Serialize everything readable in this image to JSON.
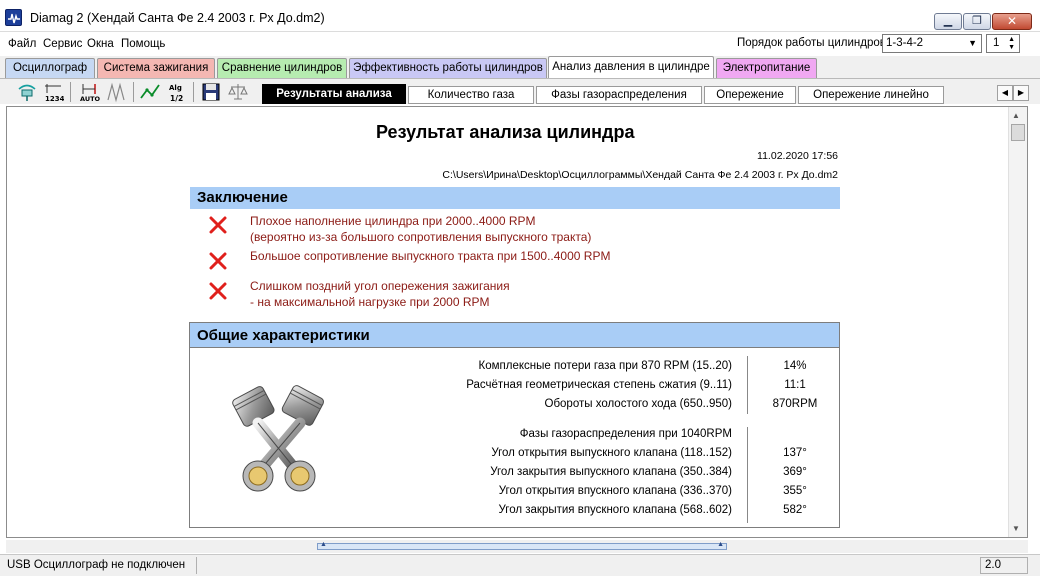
{
  "window": {
    "title": "Diamag 2 (Хендай Санта Фе 2.4 2003 г. Рх До.dm2)"
  },
  "menu": {
    "items": [
      "Файл",
      "Сервис",
      "Окна",
      "Помощь"
    ],
    "firing_order_label": "Порядок работы цилиндров",
    "firing_order_value": "1-3-4-2",
    "cylinder_value": "1"
  },
  "tabs": [
    {
      "label": "Осциллограф",
      "color": "#c6d8f3"
    },
    {
      "label": "Система зажигания",
      "color": "#f4b7b2"
    },
    {
      "label": "Сравнение цилиндров",
      "color": "#b6ecb0"
    },
    {
      "label": "Эффективность работы цилиндров",
      "color": "#c9c8f5"
    },
    {
      "label": "Анализ давления в цилиндре",
      "color": "#ffffff"
    },
    {
      "label": "Электропитание",
      "color": "#f0a8f2"
    }
  ],
  "subtabs": [
    "Результаты анализа",
    "Количество газа",
    "Фазы газораспределения",
    "Опережение",
    "Опережение линейно"
  ],
  "report": {
    "title": "Результат анализа цилиндра",
    "date": "11.02.2020 17:56",
    "path": "C:\\Users\\Ирина\\Desktop\\Осциллограммы\\Хендай Санта Фе 2.4 2003 г. Рх До.dm2",
    "conclusion_header": "Заключение",
    "conclusions": [
      {
        "line1": "Плохое наполнение цилиндра при 2000..4000 RPM",
        "line2": "(вероятно из-за большого сопротивления выпускного тракта)"
      },
      {
        "line1": "Большое сопротивление выпускного тракта при 1500..4000 RPM",
        "line2": ""
      },
      {
        "line1": "Слишком поздний угол опережения зажигания",
        "line2": "- на максимальной нагрузке при 2000 RPM"
      }
    ],
    "general_header": "Общие характеристики",
    "params": [
      {
        "label": "Комплексные потери газа при 870 RPM (15..20)",
        "value": "14%"
      },
      {
        "label": "Расчётная геометрическая степень сжатия (9..11)",
        "value": "11:1"
      },
      {
        "label": "Обороты холостого хода (650..950)",
        "value": "870RPM"
      },
      {
        "label": "Фазы газораспределения при 1040RPM",
        "value": ""
      },
      {
        "label": "Угол открытия выпускного клапана (118..152)",
        "value": "137°"
      },
      {
        "label": "Угол закрытия выпускного клапана (350..384)",
        "value": "369°"
      },
      {
        "label": "Угол открытия впускного клапана (336..370)",
        "value": "355°"
      },
      {
        "label": "Угол закрытия впускного клапана (568..602)",
        "value": "582°"
      }
    ]
  },
  "status": {
    "connection": "USB Осциллограф не подключен",
    "version": "2.0"
  },
  "icons": {
    "conclusion_mark": "x-icon",
    "error_color": "#e0201c"
  }
}
